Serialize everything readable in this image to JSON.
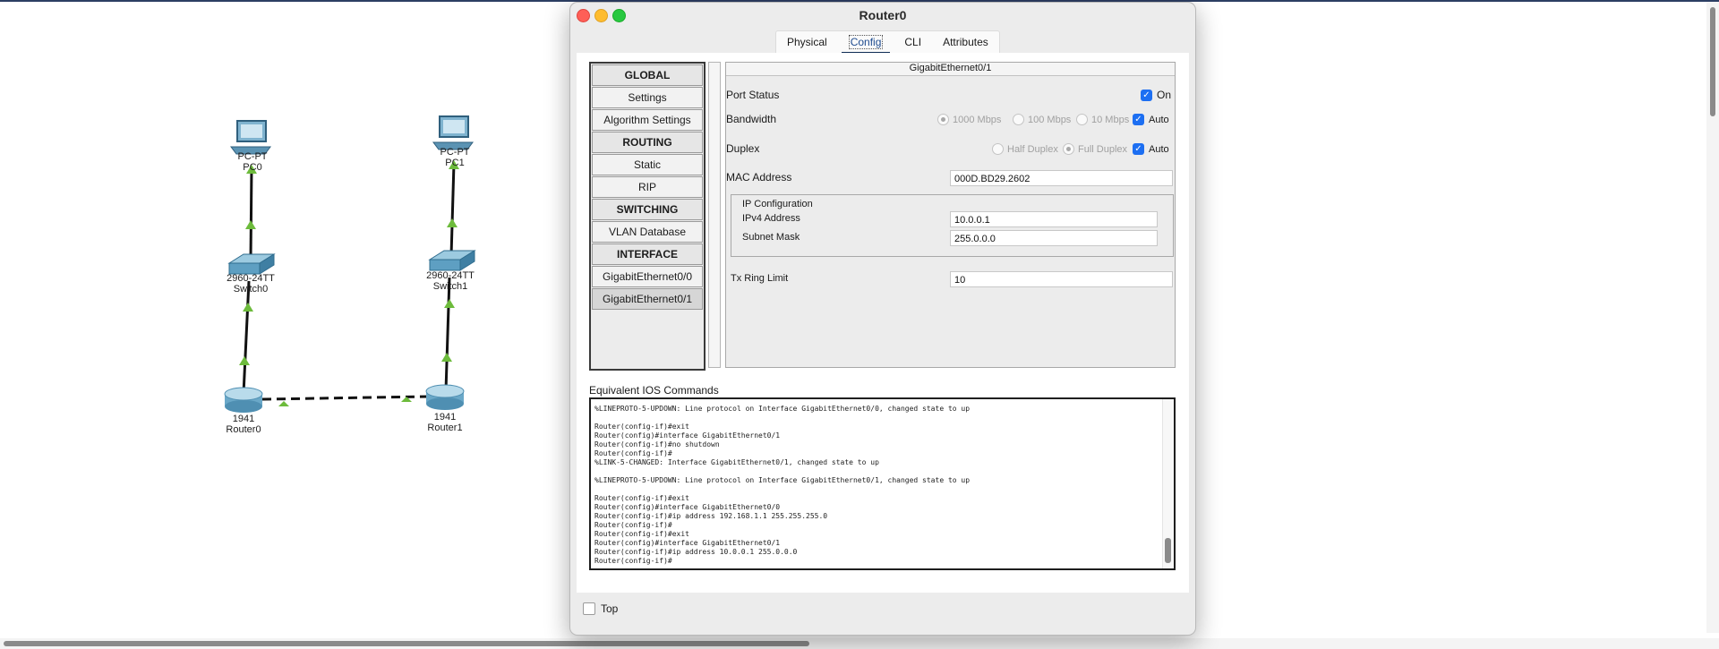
{
  "workspace": {
    "devices": [
      {
        "model": "PC-PT",
        "name": "PC0"
      },
      {
        "model": "PC-PT",
        "name": "PC1"
      },
      {
        "model": "2960-24TT",
        "name": "Switch0"
      },
      {
        "model": "2960-24TT",
        "name": "Switch1"
      },
      {
        "model": "1941",
        "name": "Router0"
      },
      {
        "model": "1941",
        "name": "Router1"
      }
    ]
  },
  "window": {
    "title": "Router0",
    "tabs": [
      "Physical",
      "Config",
      "CLI",
      "Attributes"
    ],
    "active_tab": "Config"
  },
  "nav": {
    "items": [
      {
        "label": "GLOBAL",
        "header": true
      },
      {
        "label": "Settings"
      },
      {
        "label": "Algorithm Settings"
      },
      {
        "label": "ROUTING",
        "header": true
      },
      {
        "label": "Static"
      },
      {
        "label": "RIP"
      },
      {
        "label": "SWITCHING",
        "header": true
      },
      {
        "label": "VLAN Database"
      },
      {
        "label": "INTERFACE",
        "header": true
      },
      {
        "label": "GigabitEthernet0/0"
      },
      {
        "label": "GigabitEthernet0/1",
        "selected": true
      }
    ]
  },
  "interface": {
    "title": "GigabitEthernet0/1",
    "port_status_label": "Port Status",
    "port_on_label": "On",
    "bandwidth_label": "Bandwidth",
    "bw_1000": "1000 Mbps",
    "bw_100": "100 Mbps",
    "bw_10": "10 Mbps",
    "auto_label": "Auto",
    "duplex_label": "Duplex",
    "half_duplex": "Half Duplex",
    "full_duplex": "Full Duplex",
    "mac_label": "MAC Address",
    "mac_value": "000D.BD29.2602",
    "ip_config_label": "IP Configuration",
    "ipv4_label": "IPv4 Address",
    "ipv4_value": "10.0.0.1",
    "subnet_label": "Subnet Mask",
    "subnet_value": "255.0.0.0",
    "tx_label": "Tx Ring Limit",
    "tx_value": "10",
    "check_glyph": "✓"
  },
  "ios": {
    "label": "Equivalent IOS Commands",
    "lines": [
      "%LINEPROTO-5-UPDOWN: Line protocol on Interface GigabitEthernet0/0, changed state to up",
      "",
      "Router(config-if)#exit",
      "Router(config)#interface GigabitEthernet0/1",
      "Router(config-if)#no shutdown",
      "Router(config-if)#",
      "%LINK-5-CHANGED: Interface GigabitEthernet0/1, changed state to up",
      "",
      "%LINEPROTO-5-UPDOWN: Line protocol on Interface GigabitEthernet0/1, changed state to up",
      "",
      "Router(config-if)#exit",
      "Router(config)#interface GigabitEthernet0/0",
      "Router(config-if)#ip address 192.168.1.1 255.255.255.0",
      "Router(config-if)#",
      "Router(config-if)#exit",
      "Router(config)#interface GigabitEthernet0/1",
      "Router(config-if)#ip address 10.0.0.1 255.0.0.0",
      "Router(config-if)#"
    ]
  },
  "bottom": {
    "top_label": "Top"
  },
  "colors": {
    "link_up": "#6dbb3c",
    "checkbox_blue": "#1d6ff2",
    "active_tab_bar": "#0f2c55"
  }
}
